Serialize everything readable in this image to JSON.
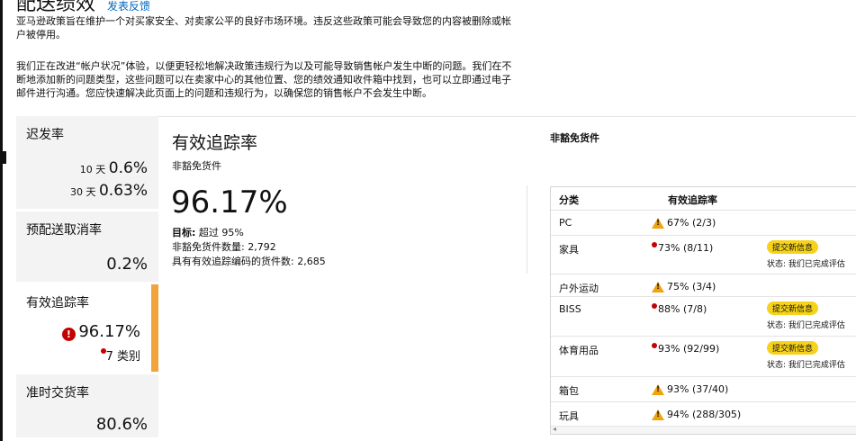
{
  "intro": {
    "title": "配送绩效",
    "title_link": "发表反馈",
    "paragraph1": "亚马逊政策旨在维护一个对买家安全、对卖家公平的良好市场环境。违反这些政策可能会导致您的内容被删除或帐户被停用。",
    "paragraph2": "我们正在改进“帐户状况”体验，以便更轻松地解决政策违规行为以及可能导致销售帐户发生中断的问题。我们在不断地添加新的问题类型，这些问题可以在卖家中心的其他位置、您的绩效通知收件箱中找到，也可以立即通过电子邮件进行沟通。您应快速解决此页面上的问题和违规行为，以确保您的销售帐户不会发生中断。"
  },
  "metrics": [
    {
      "name": "迟发率",
      "rows": [
        {
          "label": "10 天",
          "value": "0.6%"
        },
        {
          "label": "30 天",
          "value": "0.63%"
        }
      ]
    },
    {
      "name": "预配送取消率",
      "value": "0.2%"
    },
    {
      "name": "有效追踪率",
      "value": "96.17%",
      "sub": "7 类别",
      "alert": "!"
    },
    {
      "name": "准时交货率",
      "value": "80.6%"
    }
  ],
  "detail": {
    "title": "有效追踪率",
    "subtitle": "非豁免货件",
    "big_value": "96.17%",
    "target_label": "目标:",
    "target_value": "超过 95%",
    "shipments_label": "非豁免货件数量:",
    "shipments_value": "2,792",
    "tracked_label": "具有有效追踪编码的货件数:",
    "tracked_value": "2,685",
    "right_heading": "非豁免货件"
  },
  "table": {
    "headers": [
      "分类",
      "有效追踪率"
    ],
    "rows": [
      {
        "category": "PC",
        "rate": "67% (2/3)",
        "icon": "warning-icon"
      },
      {
        "category": "家具",
        "rate": "73% (8/11)",
        "icon": "error-dot-icon",
        "action": "提交新信息",
        "status": "状态:   我们已完成评估"
      },
      {
        "category": "户外运动",
        "rate": "75% (3/4)",
        "icon": "warning-icon"
      },
      {
        "category": "BISS",
        "rate": "88% (7/8)",
        "icon": "error-dot-icon",
        "action": "提交新信息",
        "status": "状态:   我们已完成评估"
      },
      {
        "category": "体育用品",
        "rate": "93% (92/99)",
        "icon": "error-dot-icon",
        "action": "提交新信息",
        "status": "状态:   我们已完成评估"
      },
      {
        "category": "箱包",
        "rate": "93% (37/40)",
        "icon": "warning-icon"
      },
      {
        "category": "玩具",
        "rate": "94% (288/305)",
        "icon": "warning-icon"
      }
    ]
  },
  "colors": {
    "accent": "#f3a33c",
    "error": "#c40000",
    "warning": "#f0a30a",
    "pill": "#f7d21a",
    "link": "#0066c0"
  }
}
